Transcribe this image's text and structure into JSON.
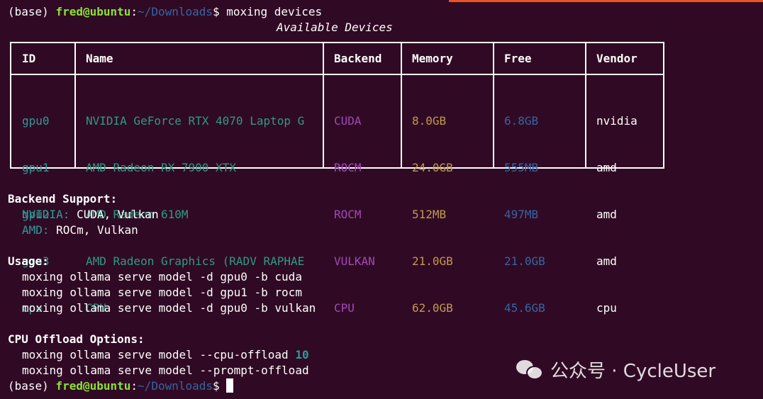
{
  "terminal": {
    "prompt_env": "(base) ",
    "prompt_user": "fred@ubuntu",
    "prompt_colon": ":",
    "prompt_path": "~/Downloads",
    "prompt_symbol": "$ ",
    "command": "moxing devices",
    "table_title": "Available Devices",
    "table": {
      "headers": [
        "ID",
        "Name",
        "Backend",
        "Memory",
        "Free",
        "Vendor"
      ],
      "rows": [
        [
          "gpu0",
          "NVIDIA GeForce RTX 4070 Laptop G",
          "CUDA",
          "8.0GB",
          "6.8GB",
          "nvidia"
        ],
        [
          "gpu1",
          "AMD Radeon RX 7900 XTX",
          "ROCM",
          "24.0GB",
          "555MB",
          "amd"
        ],
        [
          "gpu2",
          "AMD Radeon 610M",
          "ROCM",
          "512MB",
          "497MB",
          "amd"
        ],
        [
          "gpu3",
          "AMD Radeon Graphics (RADV RAPHAE",
          "VULKAN",
          "21.0GB",
          "21.0GB",
          "amd"
        ],
        [
          "cpu",
          "CPU",
          "CPU",
          "62.0GB",
          "45.6GB",
          "cpu"
        ]
      ]
    },
    "backend_support": {
      "heading": "Backend Support:",
      "nvidia_label": "NVIDIA:",
      "nvidia_value": " CUDA, Vulkan",
      "amd_label": "AMD:",
      "amd_value": " ROCm, Vulkan"
    },
    "usage": {
      "heading": "Usage:",
      "lines": [
        "moxing ollama serve model -d gpu0 -b cuda",
        "moxing ollama serve model -d gpu1 -b rocm",
        "moxing ollama serve model -d gpu0 -b vulkan"
      ]
    },
    "cpu_offload": {
      "heading": "CPU Offload Options:",
      "line1_prefix": "moxing ollama serve model --cpu-offload ",
      "line1_number": "10",
      "line2": "moxing ollama serve model --prompt-offload"
    }
  },
  "watermark": {
    "text": "公众号 · CycleUser",
    "icon": "wechat-icon"
  },
  "colors": {
    "background": "#300a24",
    "user": "#8ae234",
    "path": "#3465a4",
    "id": "#2e9a9a",
    "backend": "#a347ba",
    "memory": "#c19a4d",
    "free": "#3465a4",
    "accent": "#e95420"
  }
}
